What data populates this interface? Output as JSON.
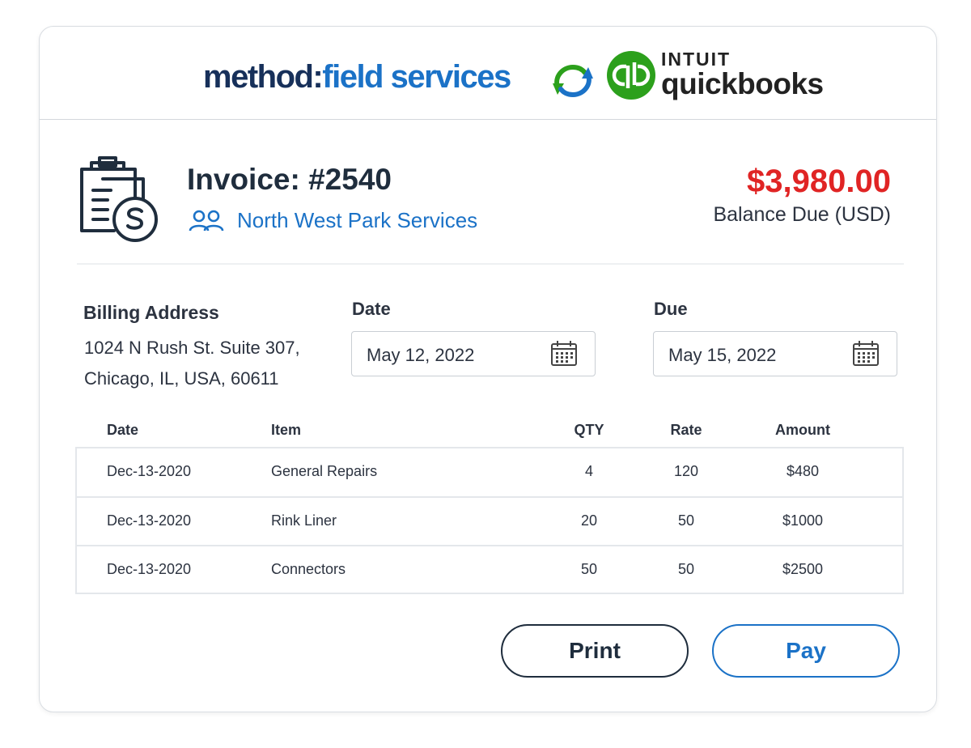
{
  "brand": {
    "method_part1": "method:",
    "method_part2": "field services",
    "qb_top": "INTUIT",
    "qb_bottom": "quickbooks"
  },
  "invoice": {
    "title": "Invoice: #2540",
    "customer": "North West Park Services",
    "balance_amount": "$3,980.00",
    "balance_label": "Balance Due (USD)"
  },
  "billing": {
    "title": "Billing Address",
    "line1": "1024 N Rush St. Suite 307,",
    "line2": "Chicago, IL, USA, 60611"
  },
  "dates": {
    "date_label": "Date",
    "date_value": "May 12, 2022",
    "due_label": "Due",
    "due_value": "May 15, 2022"
  },
  "table": {
    "headers": [
      "Date",
      "Item",
      "QTY",
      "Rate",
      "Amount"
    ],
    "rows": [
      [
        "Dec-13-2020",
        "General Repairs",
        "4",
        "120",
        "$480"
      ],
      [
        "Dec-13-2020",
        "Rink Liner",
        "20",
        "50",
        "$1000"
      ],
      [
        "Dec-13-2020",
        "Connectors",
        "50",
        "50",
        "$2500"
      ]
    ]
  },
  "actions": {
    "print": "Print",
    "pay": "Pay"
  },
  "icons": {
    "sync": "sync-arrows-icon",
    "qb_logo": "quickbooks-logo-icon",
    "invoice": "invoice-clipboard-dollar-icon",
    "customer": "users-icon",
    "calendar": "calendar-icon"
  },
  "colors": {
    "brand_navy": "#17305a",
    "brand_blue": "#1b72c7",
    "qb_green": "#2ca01c",
    "balance_red": "#e02424"
  }
}
